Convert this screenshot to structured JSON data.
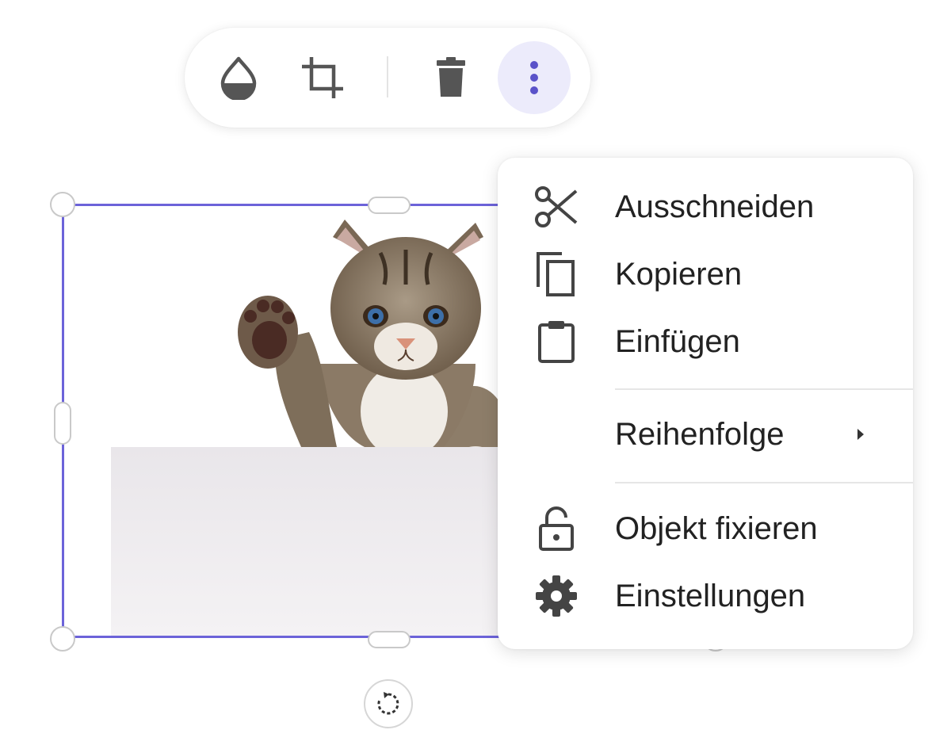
{
  "toolbar": {
    "buttons": [
      {
        "name": "color-fill",
        "icon": "drop-icon"
      },
      {
        "name": "crop",
        "icon": "crop-icon"
      },
      {
        "name": "delete",
        "icon": "trash-icon"
      },
      {
        "name": "more-options",
        "icon": "more-vertical-icon",
        "active": true
      }
    ]
  },
  "context_menu": {
    "items": [
      {
        "label": "Ausschneiden",
        "icon": "scissors-icon"
      },
      {
        "label": "Kopieren",
        "icon": "copy-icon"
      },
      {
        "label": "Einfügen",
        "icon": "clipboard-icon"
      },
      {
        "label": "Reihenfolge",
        "icon": "chevron-right-icon"
      },
      {
        "label": "Objekt fixieren",
        "icon": "lock-icon"
      },
      {
        "label": "Einstellungen",
        "icon": "gear-icon"
      }
    ]
  },
  "colors": {
    "selection": "#6c63d9",
    "active_button_bg": "#ecebfb",
    "more_dots": "#5a52c9",
    "icon_gray": "#555555"
  }
}
